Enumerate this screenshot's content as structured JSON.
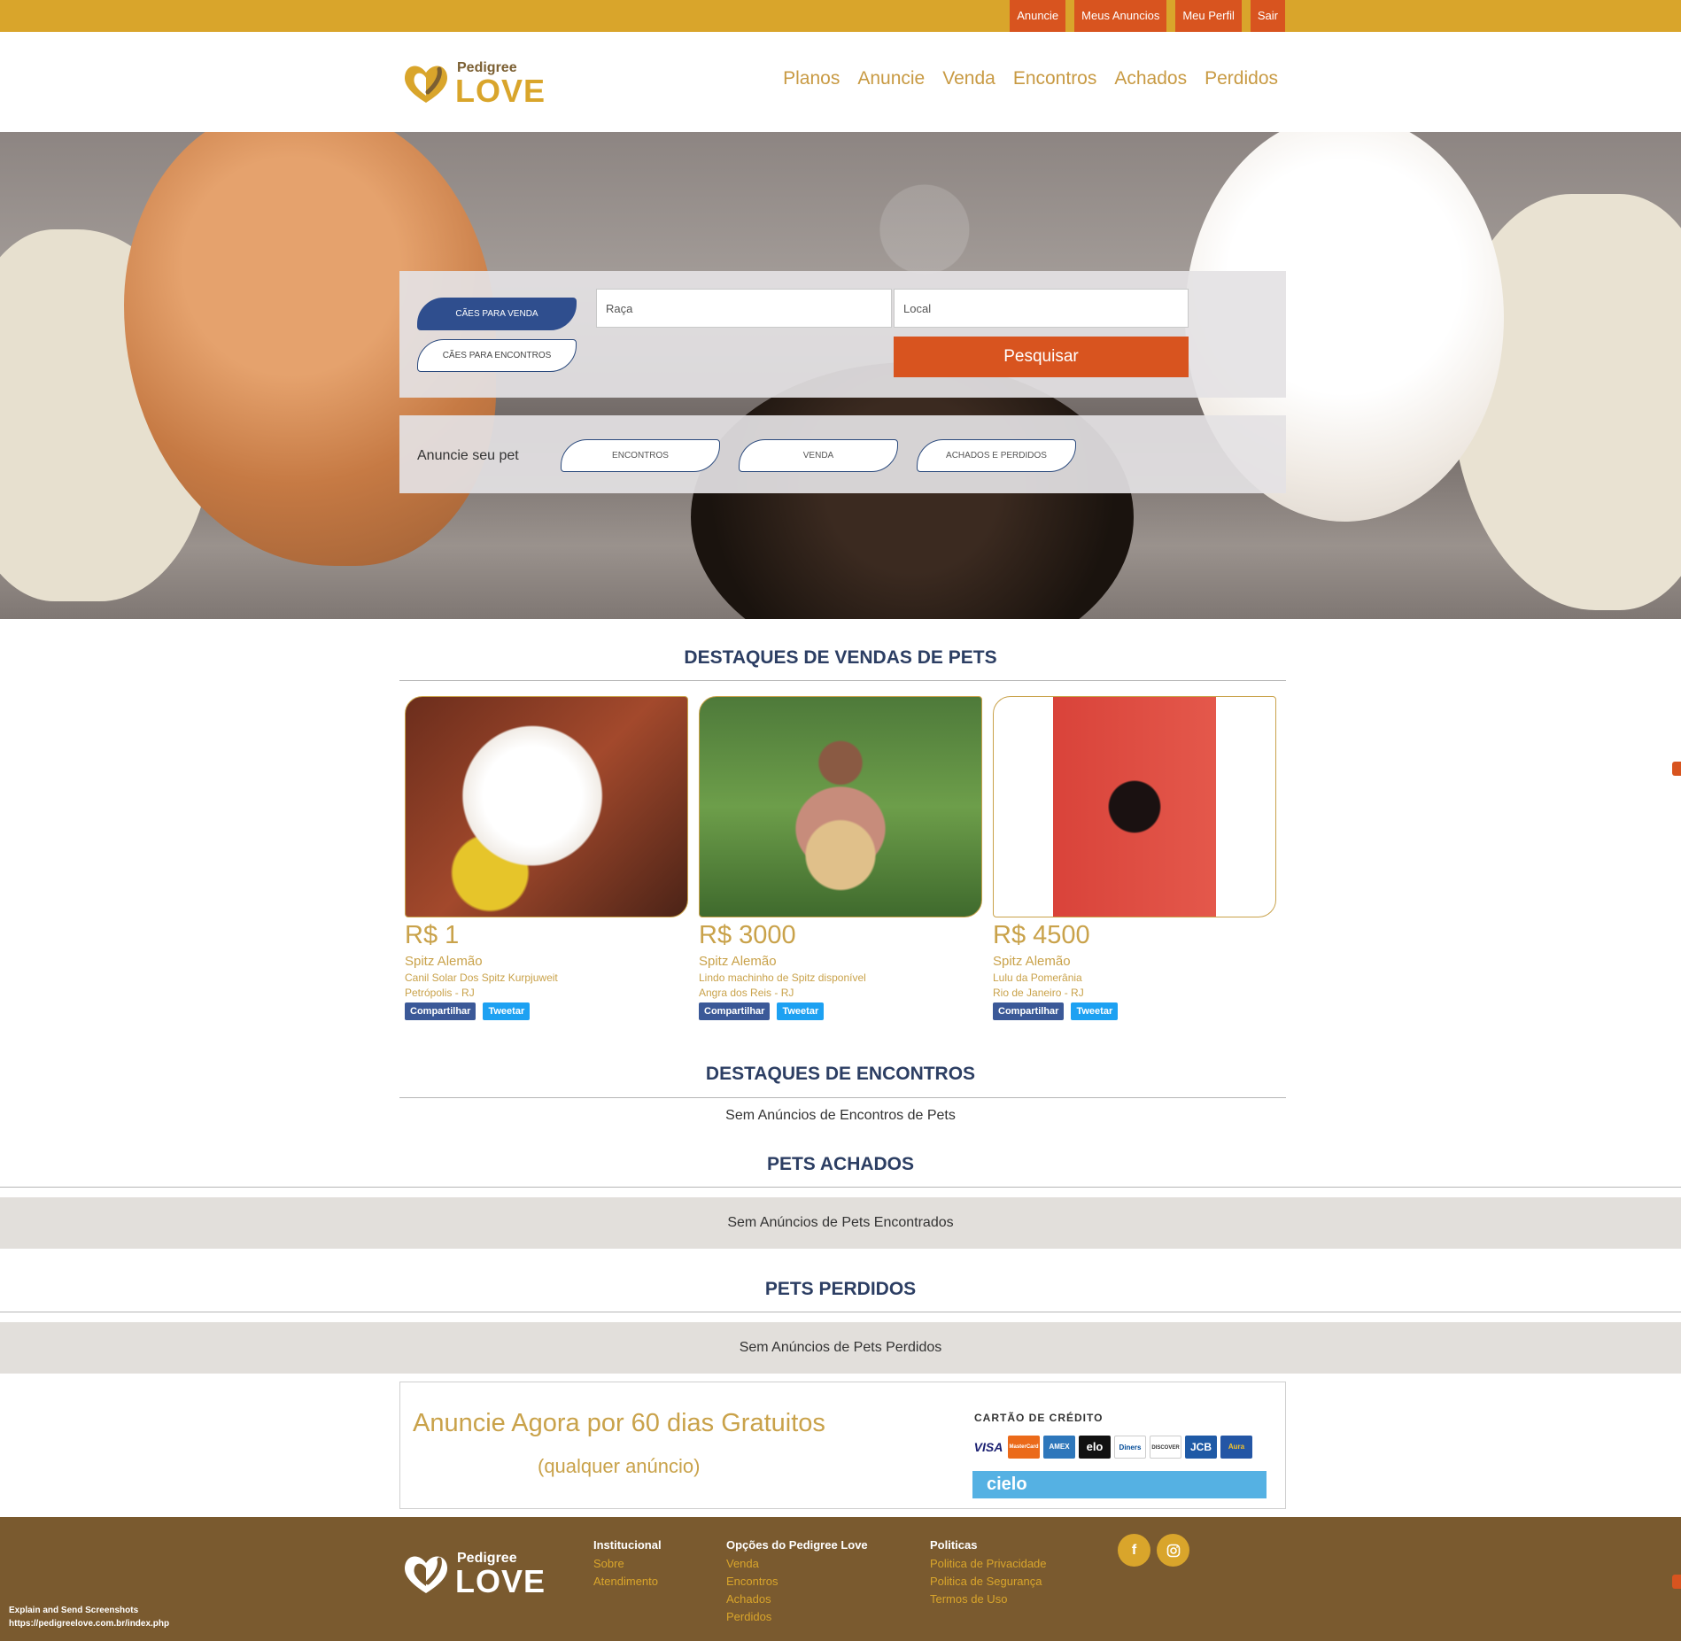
{
  "topbar": {
    "links": [
      "Anuncie",
      "Meus Anuncios",
      "Meu Perfil",
      "Sair"
    ]
  },
  "brand": {
    "small": "Pedigree",
    "big": "LOVE"
  },
  "nav": [
    "Planos",
    "Anuncie",
    "Venda",
    "Encontros",
    "Achados",
    "Perdidos"
  ],
  "search": {
    "tab_sale": "CÃES PARA VENDA",
    "tab_dating": "CÃES PARA ENCONTROS",
    "breed_placeholder": "Raça",
    "location_placeholder": "Local",
    "button": "Pesquisar"
  },
  "announce": {
    "label": "Anuncie seu pet",
    "buttons": [
      "ENCONTROS",
      "VENDA",
      "ACHADOS E PERDIDOS"
    ]
  },
  "sales": {
    "title": "DESTAQUES DE VENDAS DE PETS",
    "items": [
      {
        "price": "R$ 1",
        "breed": "Spitz Alemão",
        "desc": "Canil Solar Dos Spitz Kurpjuweit",
        "loc": "Petrópolis - RJ",
        "share": "Compartilhar",
        "tweet": "Tweetar"
      },
      {
        "price": "R$ 3000",
        "breed": "Spitz Alemão",
        "desc": "Lindo machinho de Spitz disponível",
        "loc": "Angra dos Reis - RJ",
        "share": "Compartilhar",
        "tweet": "Tweetar"
      },
      {
        "price": "R$ 4500",
        "breed": "Spitz Alemão",
        "desc": "Lulu da Pomerânia",
        "loc": "Rio de Janeiro - RJ",
        "share": "Compartilhar",
        "tweet": "Tweetar"
      }
    ]
  },
  "encounters": {
    "title": "DESTAQUES DE ENCONTROS",
    "empty": "Sem Anúncios de Encontros de Pets"
  },
  "found": {
    "title": "PETS ACHADOS",
    "empty": "Sem Anúncios de Pets Encontrados"
  },
  "lost": {
    "title": "PETS PERDIDOS",
    "empty": "Sem Anúncios de Pets Perdidos"
  },
  "promo": {
    "line1": "Anuncie Agora por 60 dias Gratuitos",
    "line2": "(qualquer anúncio)",
    "cc_title": "CARTÃO DE CRÉDITO",
    "cards": [
      "VISA",
      "MasterCard",
      "AMEX",
      "elo",
      "Diners",
      "DISCOVER",
      "JCB",
      "Aura"
    ],
    "processor": "cielo"
  },
  "footer": {
    "institucional": {
      "title": "Institucional",
      "links": [
        "Sobre",
        "Atendimento"
      ]
    },
    "opcoes": {
      "title": "Opções do Pedigree Love",
      "links": [
        "Venda",
        "Encontros",
        "Achados",
        "Perdidos"
      ]
    },
    "politicas": {
      "title": "Politicas",
      "links": [
        "Politica de Privacidade",
        "Politica de Segurança",
        "Termos de Uso"
      ]
    },
    "social_icons": [
      "facebook-icon",
      "instagram-icon"
    ],
    "note_line1": "Explain and Send Screenshots",
    "note_line2": "https://pedigreelove.com.br/index.php"
  },
  "colors": {
    "gold": "#d9a52b",
    "orange": "#d8541f",
    "navy": "#2c3e63",
    "footer_brown": "#7a5a2f"
  }
}
